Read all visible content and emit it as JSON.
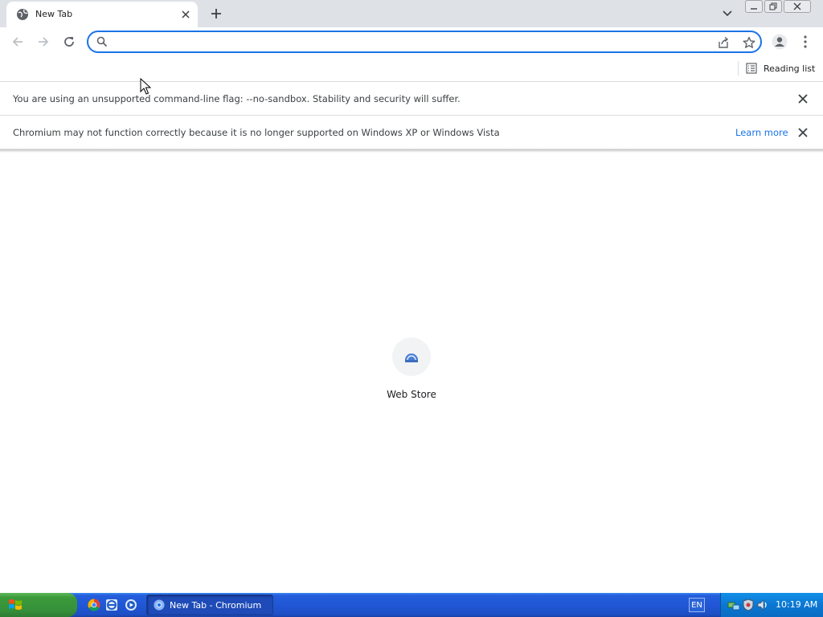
{
  "browser": {
    "tab": {
      "title": "New Tab"
    },
    "omnibox": {
      "value": "",
      "placeholder": ""
    },
    "bookmark_bar": {
      "reading_list_label": "Reading list"
    }
  },
  "infobars": [
    {
      "message": "You are using an unsupported command-line flag: --no-sandbox. Stability and security will suffer.",
      "link": ""
    },
    {
      "message": "Chromium may not function correctly because it is no longer supported on Windows XP or Windows Vista",
      "link": "Learn more"
    }
  ],
  "content": {
    "shortcuts": [
      {
        "label": "Web Store",
        "icon": "web-store-icon"
      }
    ]
  },
  "taskbar": {
    "window_item": "New Tab - Chromium",
    "language": "EN",
    "clock": "10:19 AM"
  },
  "colors": {
    "accent": "#1a73e8",
    "taskbar": "#245edb",
    "start": "#3c9a3a"
  }
}
